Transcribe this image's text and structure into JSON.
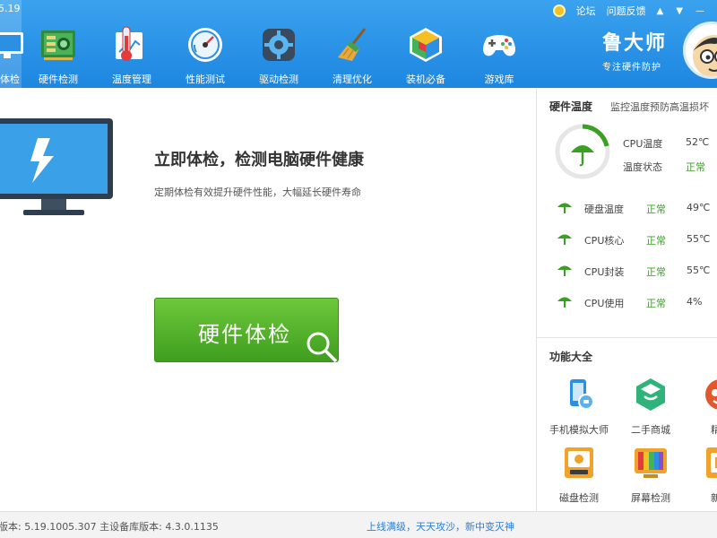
{
  "app": {
    "version_fragment": "5.19",
    "brand_title": "鲁大师",
    "brand_subtitle": "专注硬件防护"
  },
  "top_links": {
    "forum": "论坛",
    "feedback": "问题反馈"
  },
  "nav": [
    {
      "label": "体检",
      "icon": "monitor-icon"
    },
    {
      "label": "硬件检测",
      "icon": "circuit-board-icon"
    },
    {
      "label": "温度管理",
      "icon": "thermometer-icon"
    },
    {
      "label": "性能测试",
      "icon": "speedometer-icon"
    },
    {
      "label": "驱动检测",
      "icon": "gear-icon"
    },
    {
      "label": "清理优化",
      "icon": "broom-icon"
    },
    {
      "label": "装机必备",
      "icon": "cube-icon"
    },
    {
      "label": "游戏库",
      "icon": "gamepad-icon"
    }
  ],
  "main": {
    "title": "立即体检，检测电脑硬件健康",
    "subtitle": "定期体检有效提升硬件性能，大幅延长硬件寿命",
    "check_button": "硬件体检"
  },
  "temperature": {
    "heading": "硬件温度",
    "desc": "监控温度预防高温损坏",
    "cpu_temp_label": "CPU温度",
    "cpu_temp_value": "52℃",
    "temp_status_label": "温度状态",
    "temp_status_value": "正常",
    "rows": [
      {
        "name": "硬盘温度",
        "status": "正常",
        "value": "49℃"
      },
      {
        "name": "CPU核心",
        "status": "正常",
        "value": "55℃"
      },
      {
        "name": "CPU封装",
        "status": "正常",
        "value": "55℃"
      },
      {
        "name": "CPU使用",
        "status": "正常",
        "value": "4%"
      }
    ]
  },
  "functions": {
    "heading": "功能大全",
    "items": [
      {
        "label": "手机模拟大师",
        "icon": "phone-emulator-icon"
      },
      {
        "label": "二手商城",
        "icon": "shop-cube-icon"
      },
      {
        "label": "精彩",
        "icon": "game-character-icon"
      },
      {
        "label": "磁盘检测",
        "icon": "disk-icon"
      },
      {
        "label": "屏幕检测",
        "icon": "screen-test-icon"
      },
      {
        "label": "新机",
        "icon": "new-device-icon"
      }
    ]
  },
  "status": {
    "left": "版本: 5.19.1005.307  主设备库版本: 4.3.0.1135",
    "right": "上线满级，天天攻沙，新中变灭神"
  },
  "colors": {
    "header": "#1d86e0",
    "accent_green": "#3a9f23",
    "link_blue": "#2a7fd8"
  }
}
